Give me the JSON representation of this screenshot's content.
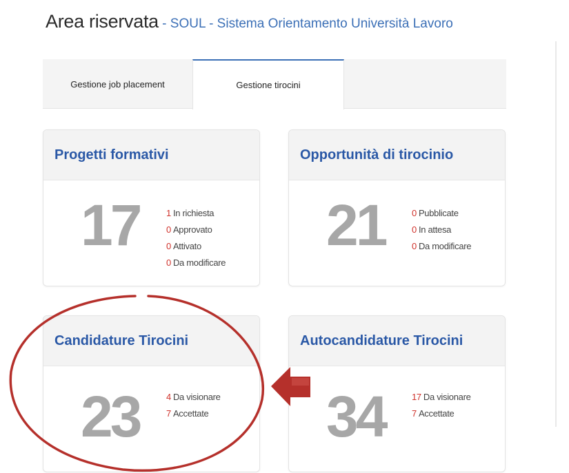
{
  "header": {
    "title": "Area riservata",
    "separator": " - ",
    "link": "SOUL - Sistema Orientamento Università Lavoro"
  },
  "tabs": [
    {
      "label": "Gestione job placement",
      "active": false
    },
    {
      "label": "Gestione tirocini",
      "active": true
    }
  ],
  "cards": [
    {
      "title": "Progetti formativi",
      "count": "17",
      "items": [
        {
          "num": "1",
          "label": "In richiesta"
        },
        {
          "num": "0",
          "label": "Approvato"
        },
        {
          "num": "0",
          "label": "Attivato"
        },
        {
          "num": "0",
          "label": "Da modificare"
        }
      ]
    },
    {
      "title": "Opportunità di tirocinio",
      "count": "21",
      "items": [
        {
          "num": "0",
          "label": "Pubblicate"
        },
        {
          "num": "0",
          "label": "In attesa"
        },
        {
          "num": "0",
          "label": "Da modificare"
        }
      ]
    },
    {
      "title": "Candidature Tirocini",
      "count": "23",
      "items": [
        {
          "num": "4",
          "label": "Da visionare"
        },
        {
          "num": "7",
          "label": "Accettate"
        }
      ]
    },
    {
      "title": "Autocandidature Tirocini",
      "count": "34",
      "items": [
        {
          "num": "17",
          "label": "Da visionare"
        },
        {
          "num": "7",
          "label": "Accettate"
        }
      ]
    }
  ],
  "colors": {
    "accent_blue": "#2a58a6",
    "count_red": "#d0322b",
    "annotation_red": "#b5302b",
    "big_number_gray": "#a7a7a7"
  }
}
